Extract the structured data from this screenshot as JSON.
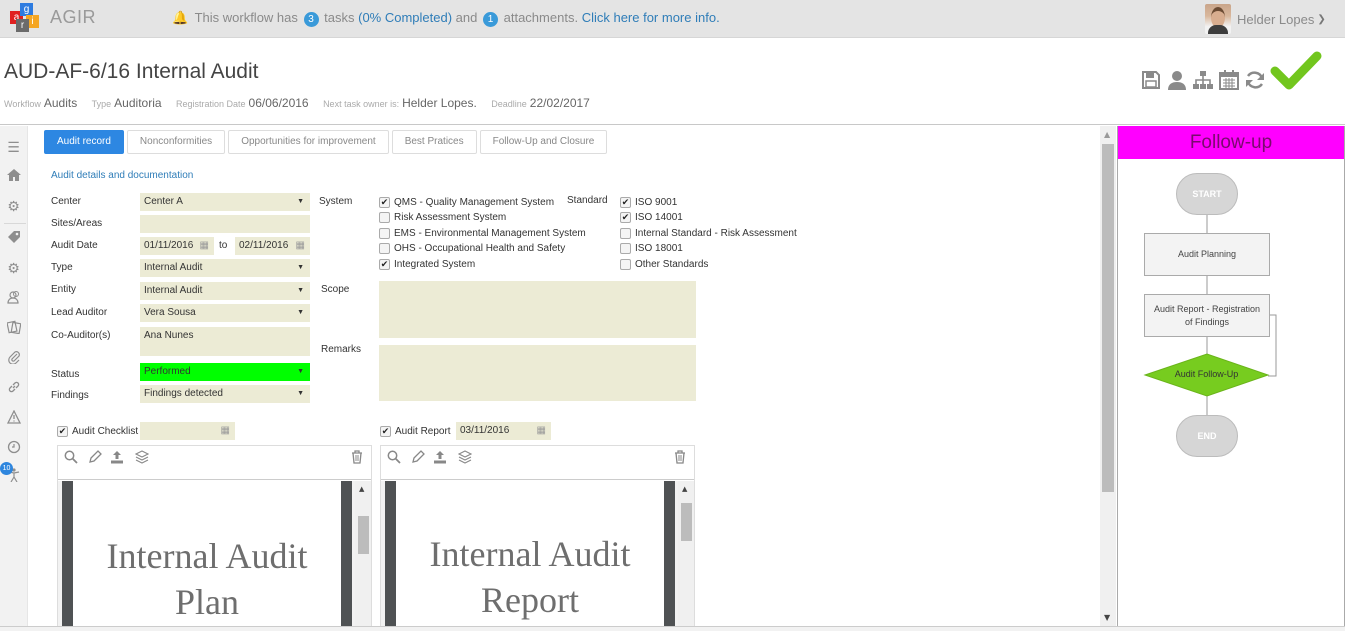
{
  "app": {
    "name": "AGIR",
    "logo_letters": [
      "a",
      "g",
      "i",
      "r"
    ]
  },
  "notice": {
    "prefix": "This workflow has",
    "task_count": "3",
    "tasks_word": "tasks",
    "completion": "(0% Completed)",
    "and_word": "and",
    "attachment_count": "1",
    "attachments_word": "attachments.",
    "link": "Click here for more info."
  },
  "user": {
    "name": "Helder Lopes"
  },
  "header": {
    "title": "AUD-AF-6/16 Internal Audit",
    "meta": [
      {
        "key": "Workflow",
        "value": "Audits"
      },
      {
        "key": "Type",
        "value": "Auditoria"
      },
      {
        "key": "Registration Date",
        "value": "06/06/2016"
      },
      {
        "key": "Next task owner is:",
        "value": "Helder Lopes."
      },
      {
        "key": "Deadline",
        "value": "22/02/2017"
      }
    ],
    "actions": [
      "save-icon",
      "user-icon",
      "hierarchy-icon",
      "calendar-icon",
      "refresh-icon",
      "checkmark-icon"
    ]
  },
  "sidebar": {
    "icons": [
      "menu-icon",
      "home-icon",
      "gears-icon",
      "tag-icon",
      "gear-icon",
      "users-icon",
      "documents-icon",
      "paperclip-icon",
      "link-icon",
      "warning-icon",
      "clock-icon",
      "person-icon"
    ],
    "badge": "10"
  },
  "tabs": [
    {
      "label": "Audit record",
      "active": true
    },
    {
      "label": "Nonconformities",
      "active": false
    },
    {
      "label": "Opportunities for improvement",
      "active": false
    },
    {
      "label": "Best Pratices",
      "active": false
    },
    {
      "label": "Follow-Up and Closure",
      "active": false
    }
  ],
  "section_title": "Audit details and documentation",
  "form": {
    "center": {
      "label": "Center",
      "value": "Center A"
    },
    "sites": {
      "label": "Sites/Areas",
      "value": ""
    },
    "audit_date": {
      "label": "Audit Date",
      "from": "01/11/2016",
      "to_word": "to",
      "to": "02/11/2016"
    },
    "type": {
      "label": "Type",
      "value": "Internal Audit"
    },
    "entity": {
      "label": "Entity",
      "value": "Internal Audit"
    },
    "lead_auditor": {
      "label": "Lead Auditor",
      "value": "Vera Sousa"
    },
    "co_auditors": {
      "label": "Co-Auditor(s)",
      "value": "Ana Nunes"
    },
    "status": {
      "label": "Status",
      "value": "Performed",
      "color": "#00ff00"
    },
    "findings": {
      "label": "Findings",
      "value": "Findings detected"
    },
    "system": {
      "label": "System",
      "options": [
        {
          "label": "QMS - Quality Management System",
          "checked": true
        },
        {
          "label": "Risk Assessment System",
          "checked": false
        },
        {
          "label": "EMS - Environmental Management System",
          "checked": false
        },
        {
          "label": "OHS - Occupational Health and Safety",
          "checked": false
        },
        {
          "label": "Integrated System",
          "checked": true
        }
      ]
    },
    "standard": {
      "label": "Standard",
      "options": [
        {
          "label": "ISO 9001",
          "checked": true
        },
        {
          "label": "ISO 14001",
          "checked": true
        },
        {
          "label": "Internal Standard - Risk Assessment",
          "checked": false
        },
        {
          "label": "ISO 18001",
          "checked": false
        },
        {
          "label": "Other Standards",
          "checked": false
        }
      ]
    },
    "scope": {
      "label": "Scope",
      "value": ""
    },
    "remarks": {
      "label": "Remarks",
      "value": ""
    }
  },
  "documents": [
    {
      "label": "Audit Checklist",
      "checked": true,
      "date": "",
      "page_text": [
        "Internal Audit",
        "Plan"
      ],
      "scroll_fraction": 0.2
    },
    {
      "label": "Audit Report",
      "checked": true,
      "date": "03/11/2016",
      "page_text": [
        "Internal Audit",
        "Report"
      ],
      "scroll_fraction": 0.05
    }
  ],
  "flowchart": {
    "title": "Follow-up",
    "title_color": "#ff00ff",
    "nodes": [
      {
        "id": "start",
        "label": "START",
        "kind": "terminal"
      },
      {
        "id": "planning",
        "label": "Audit Planning",
        "kind": "process"
      },
      {
        "id": "report",
        "label": "Audit Report - Registration of Findings",
        "kind": "process"
      },
      {
        "id": "followup",
        "label": "Audit Follow-Up",
        "kind": "decision",
        "active": true,
        "color": "#77cc1f"
      },
      {
        "id": "end",
        "label": "END",
        "kind": "terminal"
      }
    ]
  }
}
